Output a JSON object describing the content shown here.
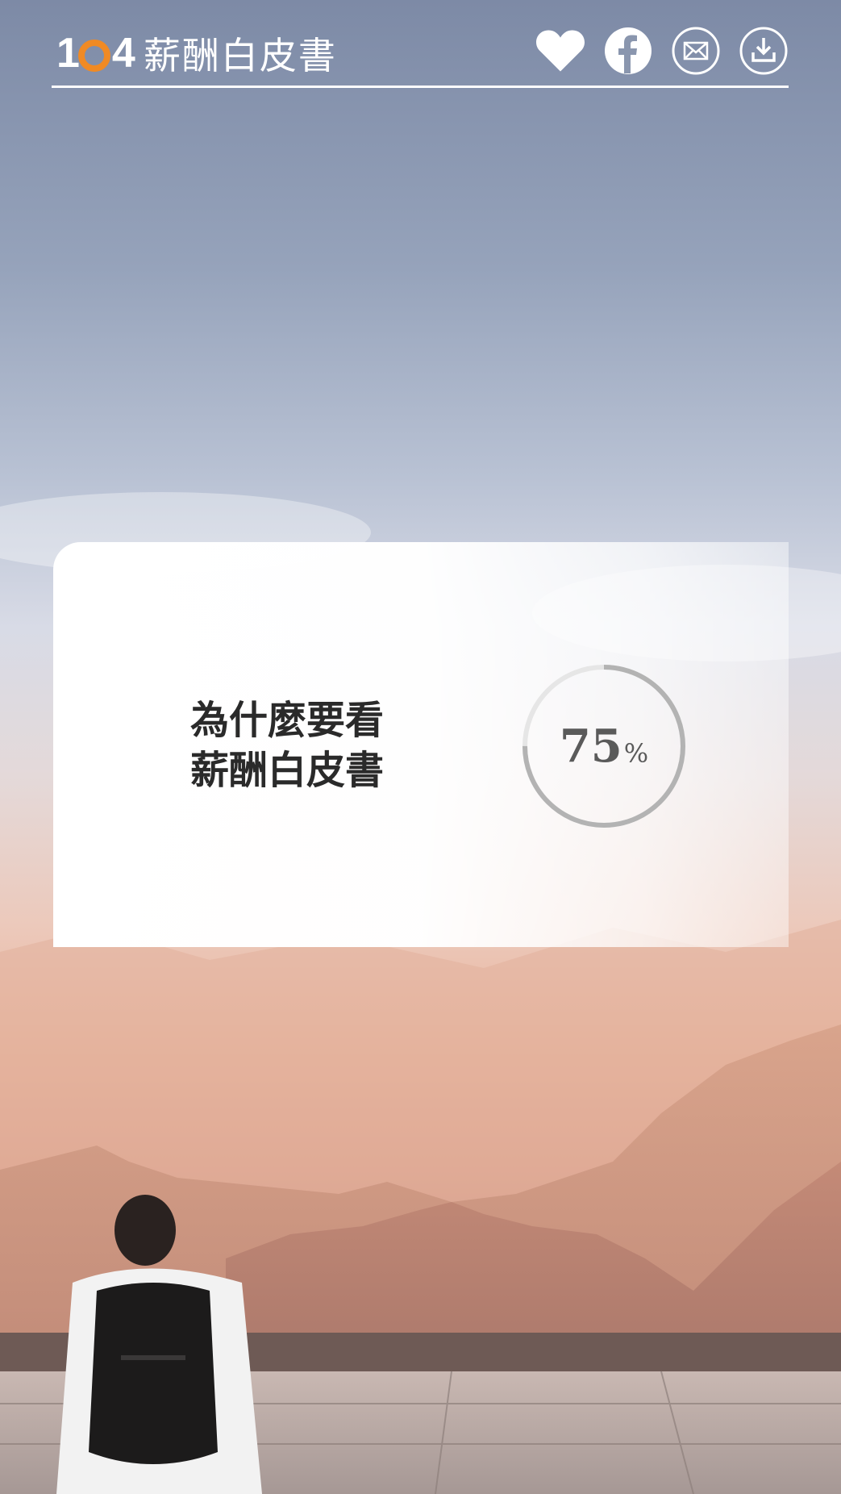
{
  "header": {
    "logo_number_1": "1",
    "logo_number_2": "4",
    "logo_title": "薪酬白皮書",
    "icons": [
      "heart-icon",
      "facebook-icon",
      "mail-icon",
      "download-icon"
    ]
  },
  "card": {
    "title_line1": "為什麼要看",
    "title_line2": "薪酬白皮書",
    "progress_value": "75",
    "progress_unit": "%",
    "progress_fraction": 0.75
  },
  "colors": {
    "logo_accent": "#f08a24",
    "ring_track": "#e6e6e6",
    "ring_fill": "#b3b3b3"
  }
}
